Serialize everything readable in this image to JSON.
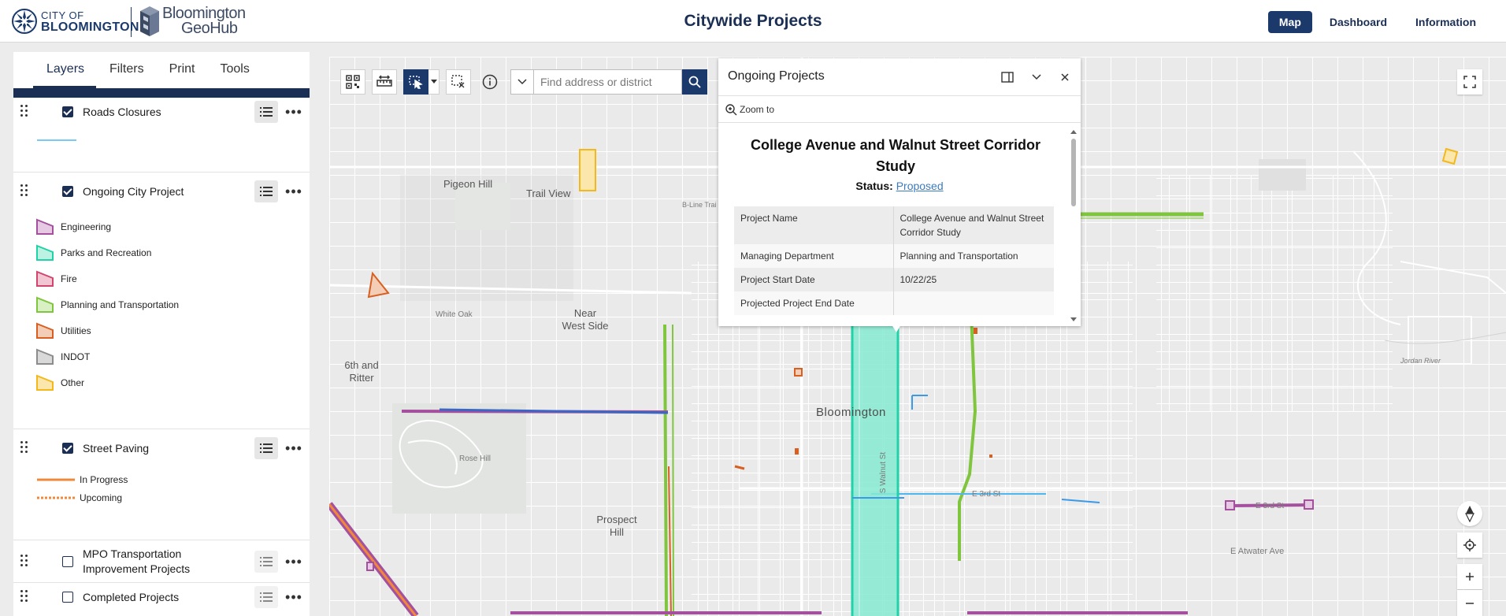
{
  "header": {
    "logo_city_line1": "CITY OF",
    "logo_city_line2": "BLOOMINGTON",
    "logo_geohub_line1": "Bloomington",
    "logo_geohub_line2": "GeoHub",
    "title": "Citywide Projects",
    "nav": [
      {
        "label": "Map",
        "active": true
      },
      {
        "label": "Dashboard",
        "active": false
      },
      {
        "label": "Information",
        "active": false
      }
    ]
  },
  "panel": {
    "tabs": [
      "Layers",
      "Filters",
      "Print",
      "Tools"
    ],
    "active_tab": "Layers",
    "layers": {
      "roads_closures": {
        "name": "Roads Closures",
        "checked": true
      },
      "ongoing": {
        "name": "Ongoing City Project",
        "checked": true,
        "legend": [
          {
            "label": "Engineering",
            "color": "#a4509e",
            "fill": "#e6c9e2"
          },
          {
            "label": "Parks and Recreation",
            "color": "#1fd3a8",
            "fill": "#bdf2e3"
          },
          {
            "label": "Fire",
            "color": "#d1456f",
            "fill": "#f2c7d3"
          },
          {
            "label": "Planning and Transportation",
            "color": "#7fc63e",
            "fill": "#d9efc4"
          },
          {
            "label": "Utilities",
            "color": "#d75f22",
            "fill": "#f4cdb6"
          },
          {
            "label": "INDOT",
            "color": "#8c8c8c",
            "fill": "#d9d9d9"
          },
          {
            "label": "Other",
            "color": "#f2b81c",
            "fill": "#fbe6ab"
          }
        ]
      },
      "street_paving": {
        "name": "Street Paving",
        "checked": true,
        "legend": [
          {
            "label": "In Progress",
            "color": "#f0883a",
            "style": "solid"
          },
          {
            "label": "Upcoming",
            "color": "#f0883a",
            "style": "dotted"
          }
        ]
      },
      "mpo": {
        "name": "MPO Transportation Improvement Projects",
        "name_line1": "MPO Transportation",
        "name_line2": "Improvement Projects",
        "checked": false
      },
      "completed": {
        "name": "Completed Projects",
        "checked": false
      }
    }
  },
  "map": {
    "search_placeholder": "Find address or district",
    "labels": {
      "pigeon_hill": "Pigeon Hill",
      "trail_view": "Trail View",
      "near_west_side": "Near West Side",
      "sixth_and_ritter": "6th and Ritter",
      "white_oak": "White Oak",
      "bloomington": "Bloomington",
      "rose_hill": "Rose Hill",
      "prospect_hill": "Prospect Hill",
      "s_walnut_st": "S Walnut St",
      "e_3rd_st": "E 3rd St",
      "e_3rd_st_2": "E 3rd St",
      "e_atwater_ave": "E Atwater Ave",
      "jordan_river": "Jordan River",
      "b_line_trail": "B-Line Trai"
    }
  },
  "popup": {
    "header": "Ongoing Projects",
    "zoom_to": "Zoom to",
    "feature_title": "College Avenue and Walnut Street Corridor Study",
    "status_label": "Status:",
    "status_value": "Proposed",
    "attributes": [
      {
        "key": "Project Name",
        "value": "College Avenue and Walnut Street Corridor Study"
      },
      {
        "key": "Managing Department",
        "value": "Planning and Transportation"
      },
      {
        "key": "Project Start Date",
        "value": "10/22/25"
      },
      {
        "key": "Projected Project End Date",
        "value": ""
      }
    ]
  }
}
